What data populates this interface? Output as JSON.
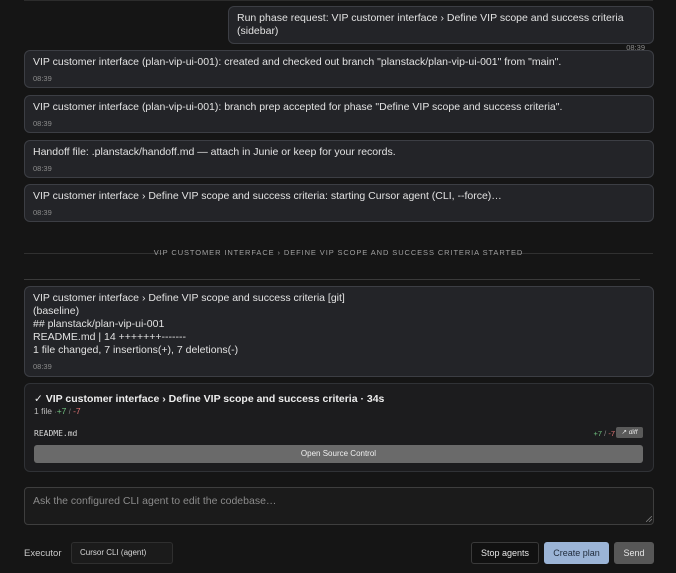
{
  "messages": [
    {
      "role": "user",
      "text": "Run phase request: VIP customer interface › Define VIP scope and success criteria (sidebar)",
      "time": "08:39"
    },
    {
      "role": "system",
      "text": "VIP customer interface (plan-vip-ui-001): created and checked out branch \"planstack/plan-vip-ui-001\" from \"main\".",
      "time": "08:39"
    },
    {
      "role": "system",
      "text": "VIP customer interface (plan-vip-ui-001): branch prep accepted for phase \"Define VIP scope and success criteria\".",
      "time": "08:39"
    },
    {
      "role": "system",
      "text": "Handoff file: .planstack/handoff.md — attach in Junie or keep for your records.",
      "time": "08:39"
    },
    {
      "role": "system",
      "text": "VIP customer interface › Define VIP scope and success criteria: starting Cursor agent (CLI, --force)…",
      "time": "08:39"
    }
  ],
  "separator": "VIP CUSTOMER INTERFACE › DEFINE VIP SCOPE AND SUCCESS CRITERIA STARTED",
  "git_message": {
    "lines": [
      "VIP customer interface › Define VIP scope and success criteria [git]",
      "(baseline)",
      "## planstack/plan-vip-ui-001",
      "README.md | 14 +++++++-------",
      "1 file changed, 7 insertions(+), 7 deletions(-)"
    ],
    "time": "08:39"
  },
  "result_card": {
    "title": "✓ VIP customer interface › Define VIP scope and success criteria · 34s",
    "files_count": "1 file",
    "added": "+7",
    "removed": "-7",
    "separator": "/",
    "file_name": "README.md",
    "diff_label": "↗ diff",
    "open_source_control": "Open Source Control"
  },
  "composer": {
    "placeholder": "Ask the configured CLI agent to edit the codebase…",
    "executor_label": "Executor",
    "executor_value": "Cursor CLI (agent)",
    "stop_label": "Stop agents",
    "create_label": "Create plan",
    "send_label": "Send"
  }
}
